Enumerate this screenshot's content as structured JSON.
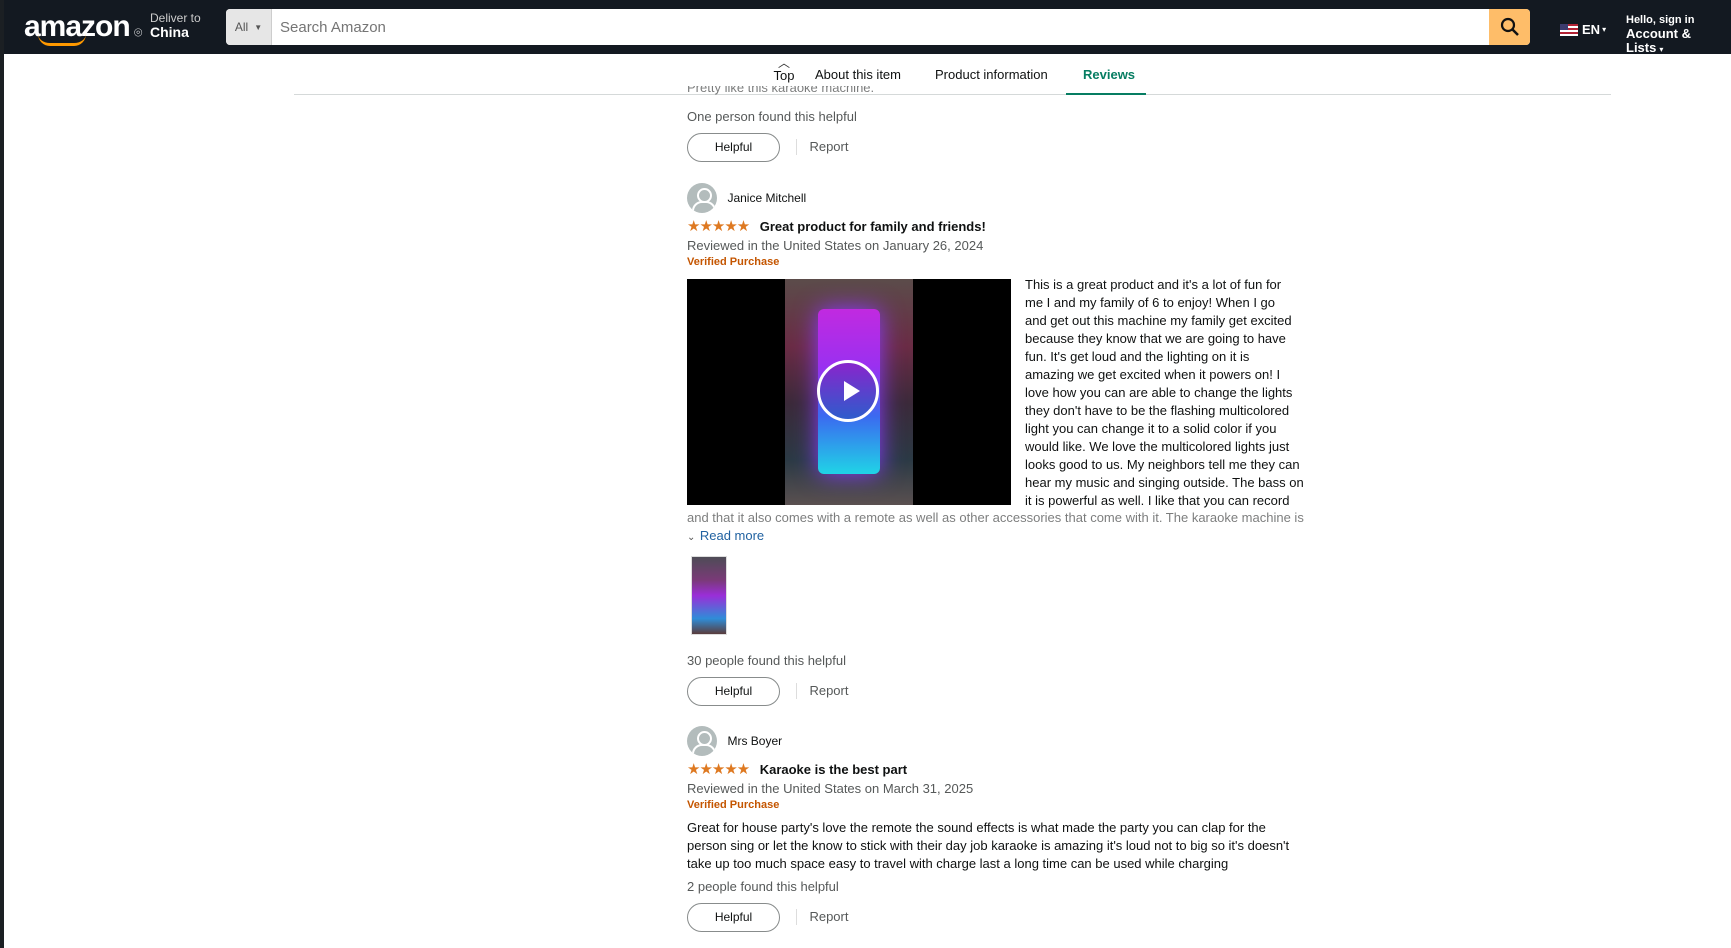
{
  "header": {
    "logo_text": "amazon",
    "deliver_label": "Deliver to",
    "deliver_location": "China",
    "search_scope": "All",
    "search_placeholder": "Search Amazon",
    "language": "EN",
    "account_greeting": "Hello, sign in",
    "account_label": "Account & Lists"
  },
  "tabs": {
    "top_label": "Top",
    "items": [
      "About this item",
      "Product information",
      "Reviews"
    ],
    "active": "Reviews",
    "accent_color": "#067d62"
  },
  "reviews": [
    {
      "partial_text": "Pretty like this karaoke machine.",
      "helpful_count": "One person found this helpful",
      "helpful_label": "Helpful",
      "report_label": "Report"
    },
    {
      "reviewer": "Janice Mitchell",
      "rating": 5,
      "stars": "★★★★★",
      "title": "Great product for family and friends!",
      "date": "Reviewed in the United States on January 26, 2024",
      "verified": "Verified Purchase",
      "body_lines": [
        "This is a great product and it's a lot of fun for",
        "me I and my family of 6 to enjoy! When I go",
        "and get out this machine my family get excited",
        "because they know that we are going to have",
        "fun. It's get loud and the lighting on it is",
        "amazing we get excited when it powers on! I",
        "love how you can are able to change the lights",
        "they don't have to be the flashing multicolored",
        "light you can change it to a solid color if you",
        "would like. We love the multicolored lights just",
        "looks good to us. My neighbors tell me they can",
        "hear my music and singing outside. The bass on",
        "it is powerful as well. I like that you can record"
      ],
      "faded_line": "and that it also comes with a remote as well as other accessories that come with it. The karaoke machine is",
      "read_more": "Read more",
      "helpful_count": "30 people found this helpful",
      "helpful_label": "Helpful",
      "report_label": "Report"
    },
    {
      "reviewer": "Mrs Boyer",
      "rating": 5,
      "stars": "★★★★★",
      "title": "Karaoke is the best part",
      "date": "Reviewed in the United States on March 31, 2025",
      "verified": "Verified Purchase",
      "body_lines": [
        "Great for house party's love the remote the sound effects is what made the party you can clap for the",
        "person sing or let the know to stick with their day job karaoke is amazing it's loud not to big so it's doesn't",
        "take up too much space easy to travel with charge last a long time can be used while charging"
      ],
      "helpful_count": "2 people found this helpful",
      "helpful_label": "Helpful",
      "report_label": "Report"
    }
  ]
}
